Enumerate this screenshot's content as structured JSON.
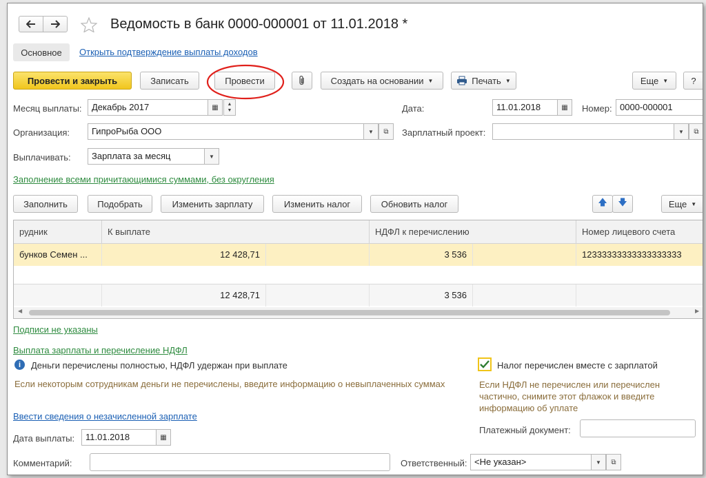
{
  "title": "Ведомость в банк 0000-000001 от 11.01.2018 *",
  "tabs": {
    "main": "Основное",
    "link": "Открыть подтверждение выплаты доходов"
  },
  "toolbar": {
    "post_close": "Провести и закрыть",
    "save": "Записать",
    "post": "Провести",
    "create_based": "Создать на основании",
    "print": "Печать",
    "more": "Еще",
    "help": "?"
  },
  "fields": {
    "month_label": "Месяц выплаты:",
    "month_value": "Декабрь 2017",
    "date_label": "Дата:",
    "date_value": "11.01.2018",
    "number_label": "Номер:",
    "number_value": "0000-000001",
    "org_label": "Организация:",
    "org_value": "ГипроРыба ООО",
    "salary_project_label": "Зарплатный проект:",
    "salary_project_value": "",
    "pay_label": "Выплачивать:",
    "pay_value": "Зарплата за месяц"
  },
  "fill_link": "Заполнение всеми причитающимися суммами, без округления",
  "table_toolbar": {
    "fill": "Заполнить",
    "pick": "Подобрать",
    "change_salary": "Изменить зарплату",
    "change_tax": "Изменить налог",
    "update_tax": "Обновить налог",
    "more": "Еще"
  },
  "table": {
    "headers": [
      "рудник",
      "К выплате",
      "НДФЛ к перечислению",
      "Номер лицевого счета"
    ],
    "rows": [
      {
        "employee": "бунков Семен ...",
        "amount": "12 428,71",
        "ndfl": "3 536",
        "account": "12333333333333333333"
      }
    ],
    "totals": {
      "amount": "12 428,71",
      "ndfl": "3 536"
    }
  },
  "bottom": {
    "signatures": "Подписи не указаны",
    "payment_section": "Выплата зарплаты и перечисление НДФЛ",
    "info_text": "Деньги перечислены  полностью, НДФЛ удержан при выплате",
    "hint_left": "Если некоторым сотрудникам деньги не перечислены, введите информацию о невыплаченных суммах",
    "checkbox_label": "Налог перечислен вместе с зарплатой",
    "checkbox_checked": true,
    "hint_right_1": "Если НДФЛ не перечислен или перечислен",
    "hint_right_2": "частично, снимите этот флажок и введите",
    "hint_right_3": "информацию об уплате",
    "unaccrued_link": "Ввести сведения о незачисленной зарплате",
    "pay_date_label": "Дата выплаты:",
    "pay_date_value": "11.01.2018",
    "pay_doc_label": "Платежный документ:",
    "pay_doc_value": "",
    "comment_label": "Комментарий:",
    "comment_value": "",
    "responsible_label": "Ответственный:",
    "responsible_value": "<Не указан>"
  },
  "colors": {
    "accent_yellow": "#f1c61d",
    "link_blue": "#1a5fb4",
    "link_green": "#2e8b3f",
    "annotation_red": "#e0201b"
  }
}
